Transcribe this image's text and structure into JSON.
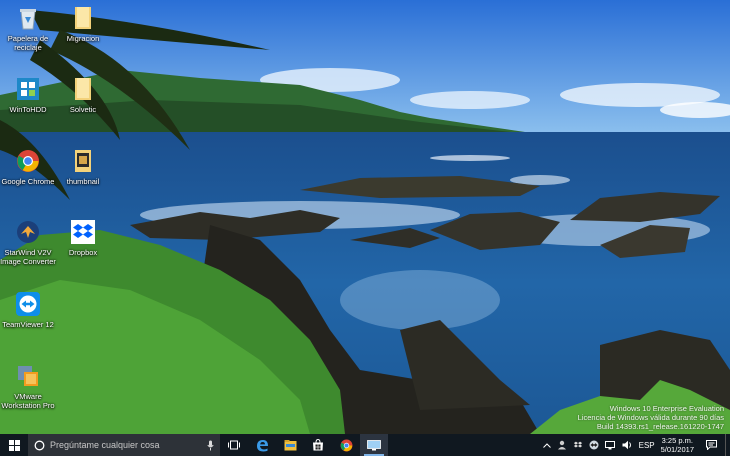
{
  "desktop": {
    "icons": [
      {
        "label": "Papelera de\nreciclaje",
        "icon": "recycle-bin-icon"
      },
      {
        "label": "Migracion",
        "icon": "folder-icon"
      },
      {
        "label": "WinToHDD",
        "icon": "wintohdd-icon"
      },
      {
        "label": "Solvetic",
        "icon": "folder-icon"
      },
      {
        "label": "Google Chrome",
        "icon": "chrome-icon"
      },
      {
        "label": "thumbnail",
        "icon": "image-file-icon"
      },
      {
        "label": "StarWind V2V\nImage Converter",
        "icon": "starwind-icon"
      },
      {
        "label": "Dropbox",
        "icon": "dropbox-icon"
      },
      {
        "label": "TeamViewer 12",
        "icon": "teamviewer-icon"
      },
      {
        "label": "VMware\nWorkstation Pro",
        "icon": "vmware-icon"
      }
    ]
  },
  "watermark": {
    "line1": "Windows 10 Enterprise Evaluation",
    "line2": "Licencia de Windows válida durante 90 días",
    "line3": "Build 14393.rs1_release.161220-1747"
  },
  "taskbar": {
    "search_placeholder": "Pregúntame cualquier cosa",
    "apps": [
      "task-view-icon",
      "edge-icon",
      "file-explorer-icon",
      "store-icon",
      "chrome-icon",
      "remote-desktop-icon"
    ],
    "language": "ESP",
    "time": "3:25 p.m.",
    "date": "5/01/2017"
  },
  "colors": {
    "taskbar_bg": "#101820",
    "search_bg": "#2d3238",
    "accent": "#7fb4e8"
  }
}
